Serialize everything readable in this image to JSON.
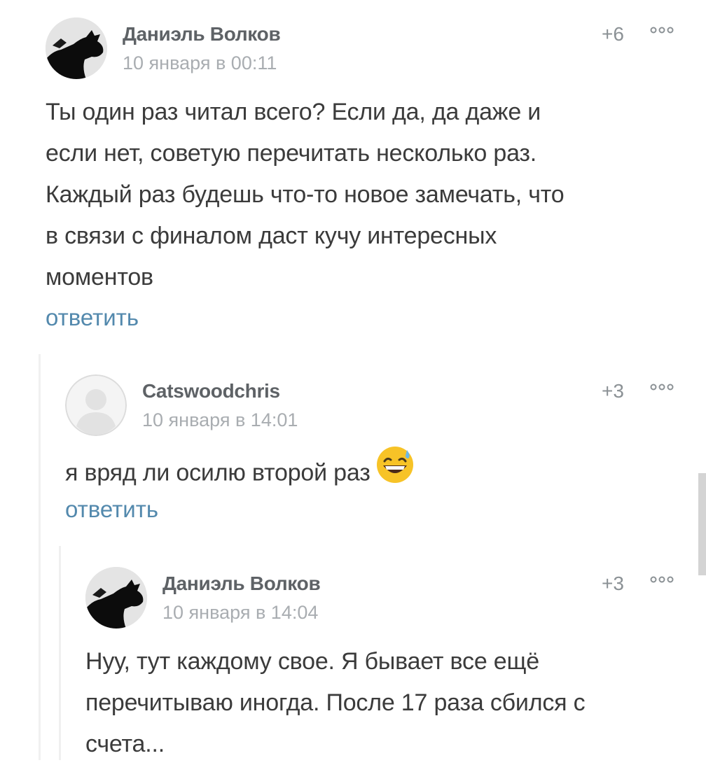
{
  "comments": [
    {
      "author": "Даниэль Волков",
      "date": "10 января в 00:11",
      "rating": "+6",
      "lines": [
        "Ты один раз читал всего? Если да, да даже и",
        "если нет, советую перечитать несколько раз.",
        "Каждый раз будешь что-то новое замечать, что",
        "в связи с финалом даст кучу интересных",
        "моментов"
      ],
      "reply_label": "ответить"
    },
    {
      "author": "Catswoodchris",
      "date": "10 января в 14:01",
      "rating": "+3",
      "text": "я вряд ли осилю второй раз",
      "emoji": "grinning-sweat-emoji",
      "reply_label": "ответить"
    },
    {
      "author": "Даниэль Волков",
      "date": "10 января в 14:04",
      "rating": "+3",
      "lines": [
        "Нуу, тут каждому свое. Я бывает все ещё",
        "перечитываю иногда. После 17 раза сбился с",
        "счета..."
      ]
    }
  ],
  "icons": {
    "more": "more-dots-icon",
    "default_avatar": "user-silhouette-icon",
    "wolf_avatar": "wolf-avatar-icon"
  },
  "colors": {
    "author": "#5e6266",
    "date": "#a9adb1",
    "reply_link": "#5389ad",
    "body_text": "#3b3b3b"
  }
}
